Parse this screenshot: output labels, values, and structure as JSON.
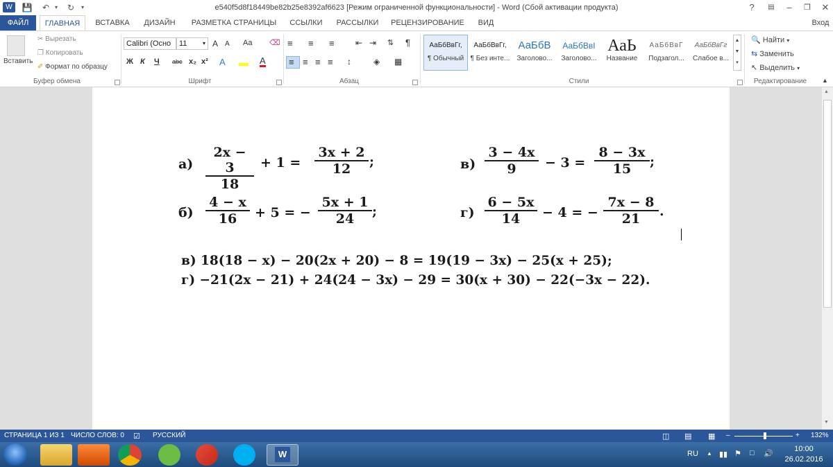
{
  "titlebar": {
    "title": "e540f5d8f18449be82b25e8392af6623 [Режим ограниченной функциональности] - Word (Сбой активации продукта)",
    "help": "?",
    "login": "Вход"
  },
  "tabs": [
    "ФАЙЛ",
    "ГЛАВНАЯ",
    "ВСТАВКА",
    "ДИЗАЙН",
    "РАЗМЕТКА СТРАНИЦЫ",
    "ССЫЛКИ",
    "РАССЫЛКИ",
    "РЕЦЕНЗИРОВАНИЕ",
    "ВИД"
  ],
  "clipboard": {
    "paste": "Вставить",
    "cut": "Вырезать",
    "copy": "Копировать",
    "format_painter": "Формат по образцу",
    "label": "Буфер обмена"
  },
  "font": {
    "name": "Calibri (Осно",
    "size": "11",
    "grow": "A",
    "shrink": "A",
    "case": "Aa",
    "bold": "Ж",
    "italic": "К",
    "underline": "Ч",
    "strike": "abc",
    "sub": "x₂",
    "sup": "x²",
    "label": "Шрифт"
  },
  "paragraph": {
    "label": "Абзац",
    "pilcrow": "¶"
  },
  "styles": {
    "label": "Стили",
    "items": [
      {
        "preview": "АаБбВвГг,",
        "name": "¶ Обычный"
      },
      {
        "preview": "АаБбВвГг,",
        "name": "¶ Без инте..."
      },
      {
        "preview": "АаБбВ",
        "name": "Заголово..."
      },
      {
        "preview": "АаБбВвI",
        "name": "Заголово..."
      },
      {
        "preview": "АаЬ",
        "name": "Название"
      },
      {
        "preview": "АаБбВвГ",
        "name": "Подзагол..."
      },
      {
        "preview": "АаБбВвГг",
        "name": "Слабое в..."
      }
    ]
  },
  "editing": {
    "find": "Найти",
    "replace": "Заменить",
    "select": "Выделить",
    "label": "Редактирование"
  },
  "document": {
    "eq_a": {
      "label": "а)",
      "num1": "2x − 3",
      "den1": "18",
      "mid": "+ 1 =",
      "num2": "3x + 2",
      "den2": "12",
      "end": ";"
    },
    "eq_v1": {
      "label": "в)",
      "num1": "3 − 4x",
      "den1": "9",
      "mid": "− 3 =",
      "num2": "8 − 3x",
      "den2": "15",
      "end": ";"
    },
    "eq_b": {
      "label": "б)",
      "num1": "4 − x",
      "den1": "16",
      "mid": "+ 5 = −",
      "num2": "5x + 1",
      "den2": "24",
      "end": ";"
    },
    "eq_g1": {
      "label": "г)",
      "num1": "6 − 5x",
      "den1": "14",
      "mid": "− 4 = −",
      "num2": "7x − 8",
      "den2": "21",
      "end": "."
    },
    "line_v": "в) 18(18 − x) − 20(2x + 20) − 8 = 19(19 − 3x) − 25(x + 25);",
    "line_g": "г) −21(2x − 21) + 24(24 − 3x) − 29 = 30(x + 30) − 22(−3x − 22)."
  },
  "status": {
    "page": "СТРАНИЦА 1 ИЗ 1",
    "words": "ЧИСЛО СЛОВ: 0",
    "lang": "РУССКИЙ",
    "zoom": "132%"
  },
  "taskbar": {
    "lang": "RU",
    "time": "10:00",
    "date": "26.02.2016"
  },
  "colors": {
    "accent": "#2b579a",
    "taskbar": "#1f4a7c"
  }
}
